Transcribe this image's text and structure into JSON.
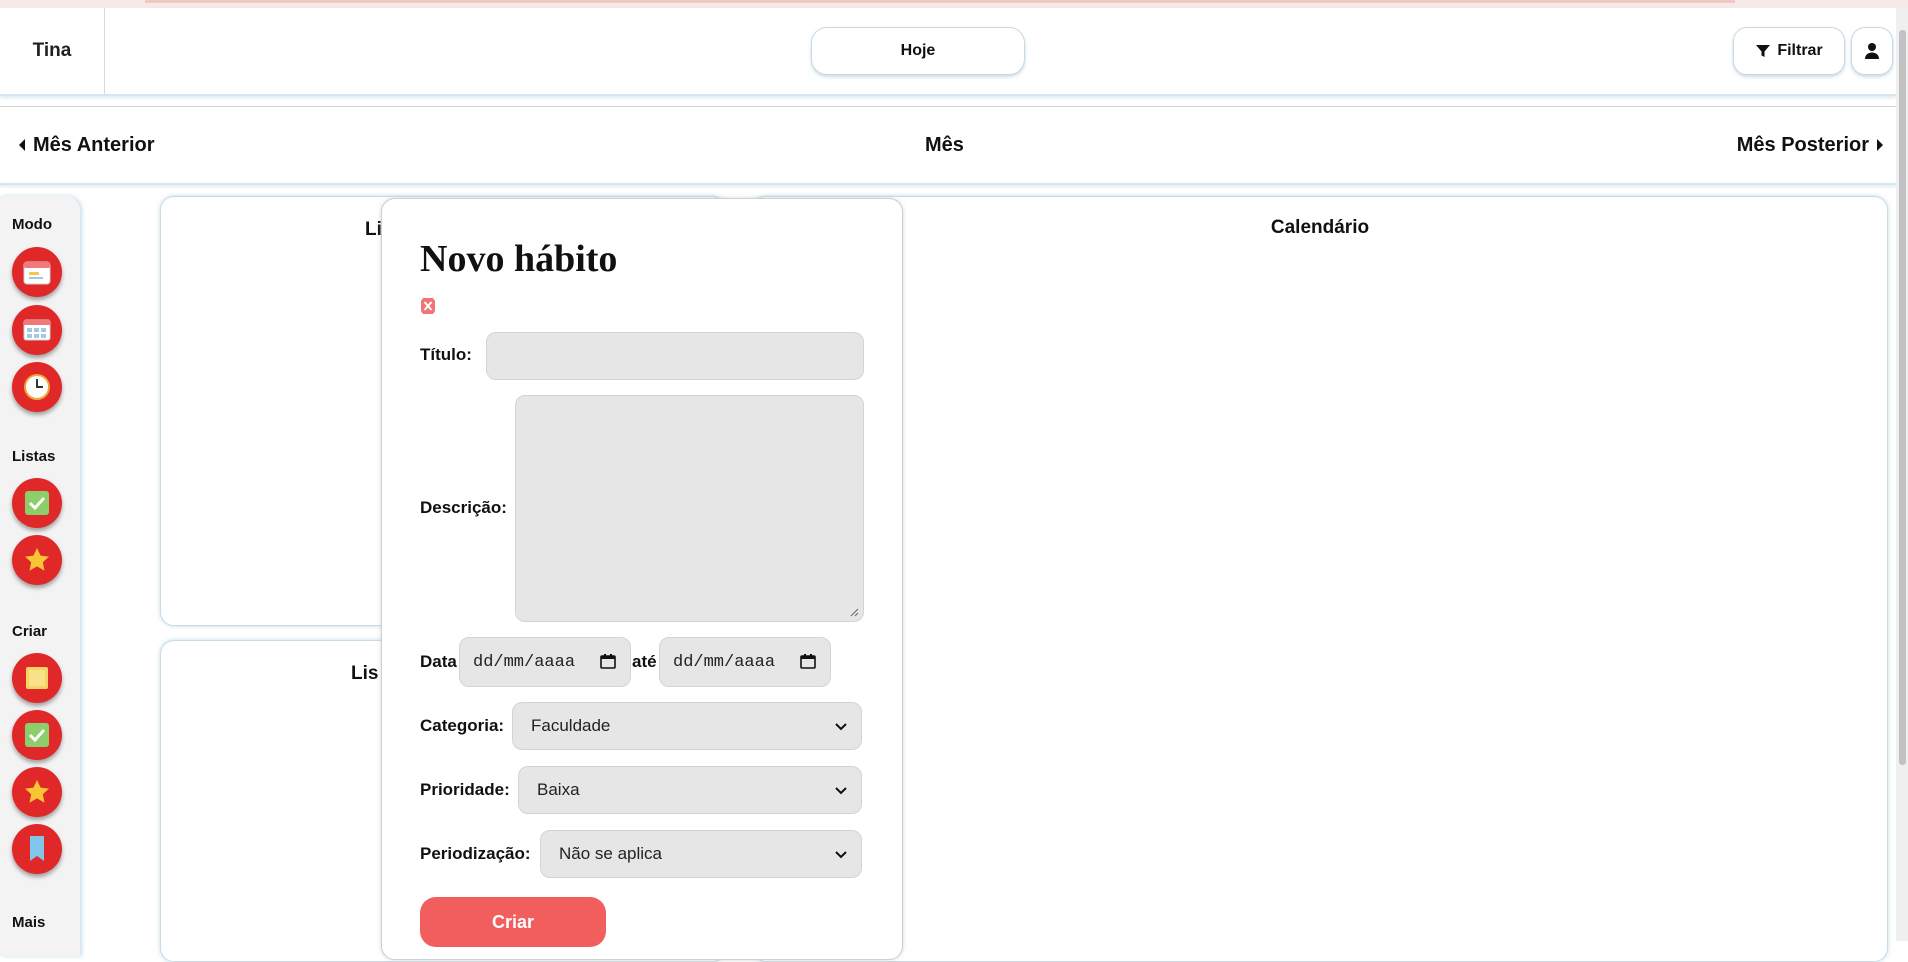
{
  "header": {
    "brand": "Tina",
    "today_label": "Hoje",
    "filter_label": "Filtrar"
  },
  "month_nav": {
    "prev_label": "Mês Anterior",
    "current_label": "Mês",
    "next_label": "Mês Posterior"
  },
  "sidebar": {
    "sections": {
      "mode": "Modo",
      "lists": "Listas",
      "create": "Criar",
      "more": "Mais"
    },
    "mode_buttons": [
      "calendar-day-icon",
      "calendar-month-icon",
      "clock-icon"
    ],
    "list_buttons": [
      "checkmark-icon",
      "star-icon"
    ],
    "create_buttons": [
      "note-icon",
      "checkmark-icon",
      "star-icon",
      "bookmark-icon"
    ]
  },
  "panels": {
    "list_top_title": "Li",
    "list_bottom_title": "Lis",
    "calendar_title": "Calendário"
  },
  "modal": {
    "title": "Novo hábito",
    "labels": {
      "title": "Título:",
      "description": "Descrição:",
      "date": "Data",
      "until": "até",
      "category": "Categoria:",
      "priority": "Prioridade:",
      "periodization": "Periodização:"
    },
    "fields": {
      "title_value": "",
      "description_value": "",
      "date_start_placeholder": "dd/mm/aaaa",
      "date_end_placeholder": "dd/mm/aaaa",
      "category_value": "Faculdade",
      "priority_value": "Baixa",
      "periodization_value": "Não se aplica"
    },
    "submit_label": "Criar"
  },
  "colors": {
    "accent_red": "#e02828",
    "submit_red": "#f25d5d",
    "field_gray": "#e6e6e6"
  }
}
